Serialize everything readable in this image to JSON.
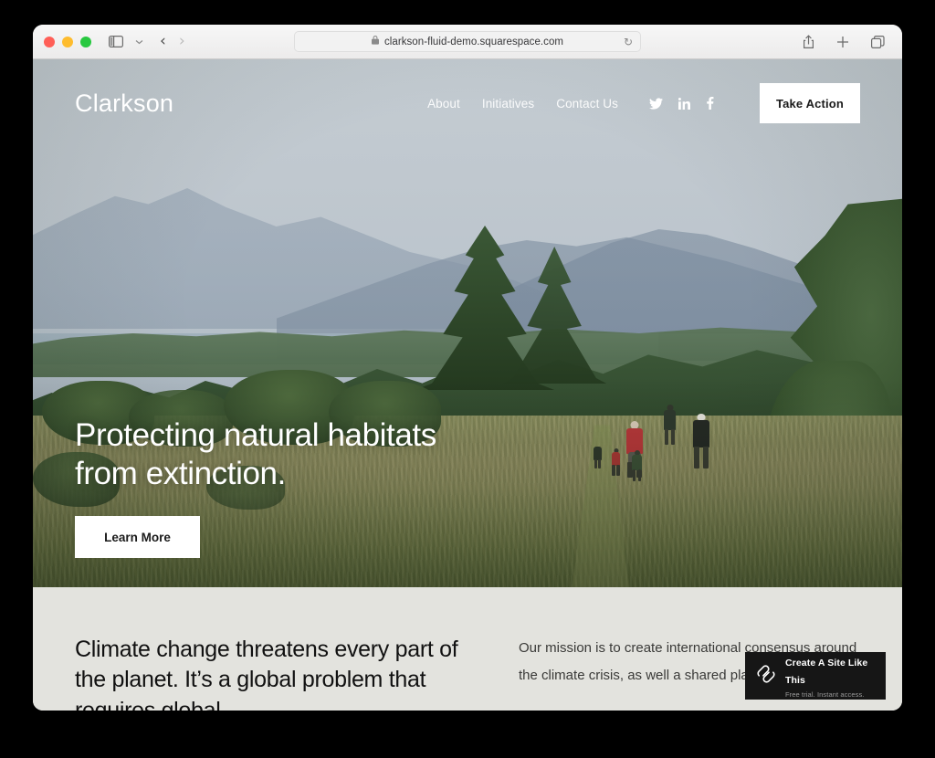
{
  "browser": {
    "window_controls": [
      "close",
      "minimize",
      "maximize"
    ],
    "sidebar_icon": "sidebar-icon",
    "chevron_icon": "chevron-down-icon",
    "back_icon": "back-arrow-icon",
    "forward_icon": "forward-arrow-icon",
    "url": "clarkson-fluid-demo.squarespace.com",
    "lock_icon": "lock-icon",
    "reload_icon": "reload-icon",
    "share_icon": "share-icon",
    "new_tab_icon": "plus-icon",
    "tabs_icon": "tab-overview-icon"
  },
  "site": {
    "logo": "Clarkson",
    "nav": [
      {
        "label": "About"
      },
      {
        "label": "Initiatives"
      },
      {
        "label": "Contact Us"
      }
    ],
    "socials": [
      {
        "name": "twitter-icon"
      },
      {
        "name": "linkedin-icon"
      },
      {
        "name": "facebook-icon"
      }
    ],
    "cta": "Take Action"
  },
  "hero": {
    "title": "Protecting natural habitats\nfrom extinction.",
    "button": "Learn More"
  },
  "section2": {
    "heading": "Climate change threatens every part of the planet. It’s a global problem that requires global",
    "body": "Our mission is to create international consensus around the climate crisis, as well a shared plan for sol"
  },
  "squarespace_banner": {
    "logo_icon": "squarespace-logo-icon",
    "title": "Create A Site Like This",
    "subtitle": "Free trial. Instant access."
  },
  "colors": {
    "banner_bg": "#161616",
    "section_bg": "#e3e3de",
    "button_bg": "#ffffff",
    "text_dark": "#111111"
  }
}
